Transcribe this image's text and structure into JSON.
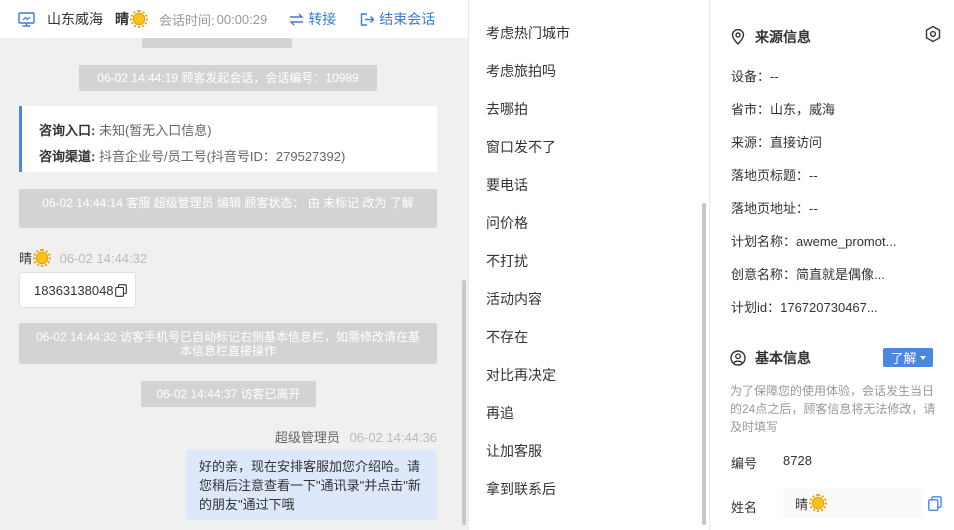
{
  "header": {
    "location": "山东威海",
    "visitor_name": "晴",
    "session_time_label": "会话时间:",
    "session_time": "00:00:29",
    "transfer_label": "转接",
    "end_label": "结束会话"
  },
  "chat": {
    "messages": [
      {
        "text": "06-02 14:44:19 顾客发起会话，会话编号：10989"
      },
      {
        "text": "06-02 14:44:14 客服 超级管理员 编辑 顾客状态： 由 未标记 改为 了解"
      },
      {
        "sender": "晴",
        "time": "06-02 14:44:32",
        "content": "18363138048"
      },
      {
        "text": "06-02 14:44:32 访客手机号已自动标记右侧基本信息栏，如需修改请在基本信息栏直接操作"
      },
      {
        "text": "06-02 14:44:37 访客已离开"
      },
      {
        "sender": "超级管理员",
        "time": "06-02 14:44:36",
        "content": "好的亲，现在安排客服加您介绍哈。请您稍后注意查看一下\"通讯录\"并点击\"新的朋友\"通过下哦"
      }
    ],
    "source_card": {
      "entry_label": "咨询入口:",
      "entry_value": "未知(暂无入口信息)",
      "channel_label": "咨询渠道:",
      "channel_value": "抖音企业号/员工号(抖音号ID：279527392)"
    }
  },
  "quick_replies": [
    "考虑热门城市",
    "考虑旅拍吗",
    "去哪拍",
    "窗口发不了",
    "要电话",
    "问价格",
    "不打扰",
    "活动内容",
    "不存在",
    "对比再决定",
    "再追",
    "让加客服",
    "拿到联系后"
  ],
  "source_info": {
    "title": "来源信息",
    "rows": [
      "设备：--",
      "省市：山东，威海",
      "来源：直接访问",
      "落地页标题：--",
      "落地页地址：--",
      "计划名称：aweme_promot...",
      "创意名称：简直就是偶像...",
      "计划id：176720730467..."
    ]
  },
  "basic_info": {
    "title": "基本信息",
    "status_label": "了解",
    "notice": "为了保障您的使用体验，会话发生当日的24点之后，顾客信息将无法修改，请及时填写",
    "id_label": "编号",
    "id_value": "8728",
    "name_label": "姓名",
    "name_value": "晴"
  },
  "colors": {
    "accent": "#4a87e0",
    "link": "#3a7bd5",
    "system_pill": "#d3d3d3",
    "agent_bubble": "#dde8fa",
    "chat_bg": "#f0f0f0"
  },
  "icons": [
    "monitor-icon",
    "sun-emoji-icon",
    "transfer-icon",
    "exit-icon",
    "copy-icon",
    "location-pin-icon",
    "eye-icon",
    "user-circle-icon",
    "caret-down-icon"
  ]
}
